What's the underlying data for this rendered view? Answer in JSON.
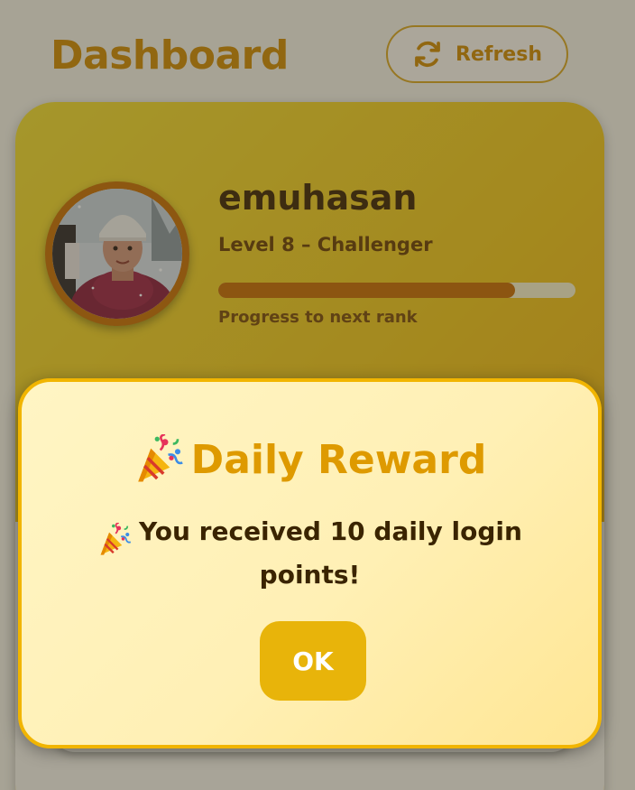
{
  "header": {
    "title": "Dashboard",
    "refresh_label": "Refresh",
    "refresh_icon": "refresh-icon"
  },
  "profile": {
    "username": "emuhasan",
    "level": "Level 8 – Challenger",
    "progress_fraction": 0.83,
    "progress_label": "Progress to next rank",
    "avatar": "user-photo"
  },
  "modal": {
    "icon": "party-popper-icon",
    "title": "Daily Reward",
    "message": "You received 10 daily login points!",
    "ok_label": "OK"
  },
  "colors": {
    "accent": "#de9a00",
    "card_gradient_start": "#f2dc2e",
    "card_gradient_end": "#e9a40b",
    "progress_fill": "#c66c00",
    "ok_button": "#e8b40a"
  }
}
